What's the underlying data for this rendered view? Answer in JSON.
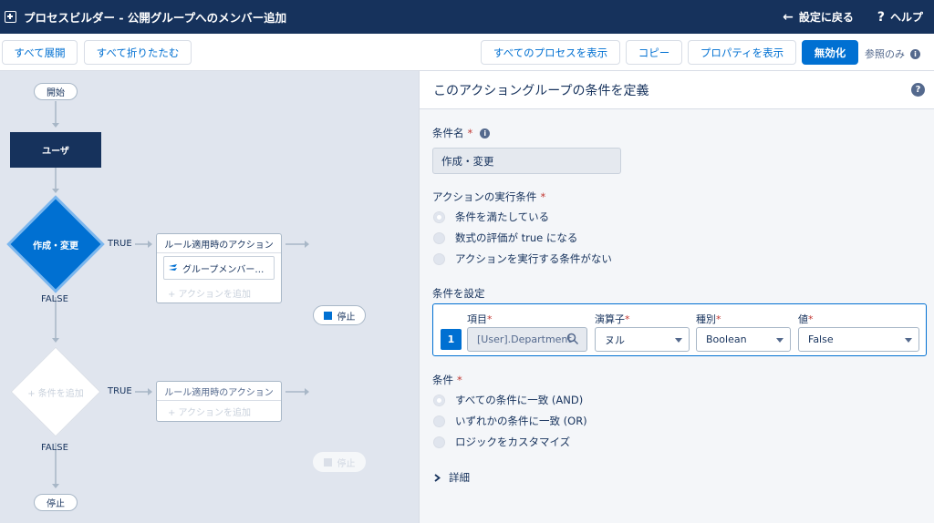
{
  "header": {
    "title": "プロセスビルダー - 公開グループへのメンバー追加",
    "back_label": "設定に戻る",
    "help_label": "ヘルプ"
  },
  "toolbar": {
    "expand_all": "すべて展開",
    "collapse_all": "すべて折りたたむ",
    "view_all": "すべてのプロセスを表示",
    "copy": "コピー",
    "properties": "プロパティを表示",
    "deactivate": "無効化",
    "readonly": "参照のみ"
  },
  "canvas": {
    "start": "開始",
    "object": "ユーザ",
    "criteria1": "作成・変更",
    "true1": "TRUE",
    "false1": "FALSE",
    "immediate1": "ルール適用時のアクション",
    "action1": "グループメンバー…",
    "add_action1": "+ アクションを追加",
    "stop1": "停止",
    "criteria2": "+ 条件を追加",
    "true2": "TRUE",
    "false2": "FALSE",
    "immediate2": "ルール適用時のアクション",
    "add_action2": "+ アクションを追加",
    "stop2": "停止",
    "stop_end": "停止"
  },
  "panel": {
    "title": "このアクショングループの条件を定義",
    "criteria_name_label": "条件名",
    "criteria_name_value": "作成・変更",
    "exec_label": "アクションの実行条件",
    "exec_options": [
      "条件を満たしている",
      "数式の評価が true になる",
      "アクションを実行する条件がない"
    ],
    "set_conditions_label": "条件を設定",
    "condition_row": {
      "number": "1",
      "field_label": "項目",
      "field_value": "[User].Department",
      "operator_label": "演算子",
      "operator_value": "ヌル",
      "type_label": "種別",
      "type_value": "Boolean",
      "value_label": "値",
      "value_value": "False"
    },
    "logic_label": "条件",
    "logic_options": [
      "すべての条件に一致 (AND)",
      "いずれかの条件に一致 (OR)",
      "ロジックをカスタマイズ"
    ],
    "details_label": "詳細"
  },
  "colors": {
    "navy": "#16325c",
    "brand": "#0070d2",
    "required": "#c23934"
  }
}
